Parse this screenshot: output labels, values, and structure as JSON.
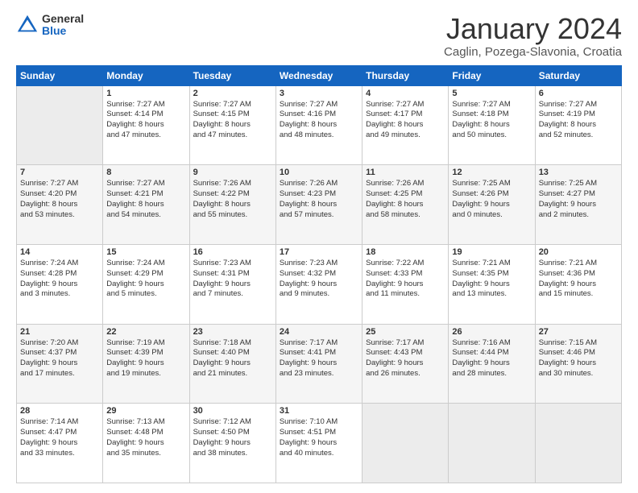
{
  "logo": {
    "general": "General",
    "blue": "Blue"
  },
  "title": "January 2024",
  "subtitle": "Caglin, Pozega-Slavonia, Croatia",
  "headers": [
    "Sunday",
    "Monday",
    "Tuesday",
    "Wednesday",
    "Thursday",
    "Friday",
    "Saturday"
  ],
  "weeks": [
    [
      {
        "day": "",
        "info": ""
      },
      {
        "day": "1",
        "info": "Sunrise: 7:27 AM\nSunset: 4:14 PM\nDaylight: 8 hours\nand 47 minutes."
      },
      {
        "day": "2",
        "info": "Sunrise: 7:27 AM\nSunset: 4:15 PM\nDaylight: 8 hours\nand 47 minutes."
      },
      {
        "day": "3",
        "info": "Sunrise: 7:27 AM\nSunset: 4:16 PM\nDaylight: 8 hours\nand 48 minutes."
      },
      {
        "day": "4",
        "info": "Sunrise: 7:27 AM\nSunset: 4:17 PM\nDaylight: 8 hours\nand 49 minutes."
      },
      {
        "day": "5",
        "info": "Sunrise: 7:27 AM\nSunset: 4:18 PM\nDaylight: 8 hours\nand 50 minutes."
      },
      {
        "day": "6",
        "info": "Sunrise: 7:27 AM\nSunset: 4:19 PM\nDaylight: 8 hours\nand 52 minutes."
      }
    ],
    [
      {
        "day": "7",
        "info": "Sunrise: 7:27 AM\nSunset: 4:20 PM\nDaylight: 8 hours\nand 53 minutes."
      },
      {
        "day": "8",
        "info": "Sunrise: 7:27 AM\nSunset: 4:21 PM\nDaylight: 8 hours\nand 54 minutes."
      },
      {
        "day": "9",
        "info": "Sunrise: 7:26 AM\nSunset: 4:22 PM\nDaylight: 8 hours\nand 55 minutes."
      },
      {
        "day": "10",
        "info": "Sunrise: 7:26 AM\nSunset: 4:23 PM\nDaylight: 8 hours\nand 57 minutes."
      },
      {
        "day": "11",
        "info": "Sunrise: 7:26 AM\nSunset: 4:25 PM\nDaylight: 8 hours\nand 58 minutes."
      },
      {
        "day": "12",
        "info": "Sunrise: 7:25 AM\nSunset: 4:26 PM\nDaylight: 9 hours\nand 0 minutes."
      },
      {
        "day": "13",
        "info": "Sunrise: 7:25 AM\nSunset: 4:27 PM\nDaylight: 9 hours\nand 2 minutes."
      }
    ],
    [
      {
        "day": "14",
        "info": "Sunrise: 7:24 AM\nSunset: 4:28 PM\nDaylight: 9 hours\nand 3 minutes."
      },
      {
        "day": "15",
        "info": "Sunrise: 7:24 AM\nSunset: 4:29 PM\nDaylight: 9 hours\nand 5 minutes."
      },
      {
        "day": "16",
        "info": "Sunrise: 7:23 AM\nSunset: 4:31 PM\nDaylight: 9 hours\nand 7 minutes."
      },
      {
        "day": "17",
        "info": "Sunrise: 7:23 AM\nSunset: 4:32 PM\nDaylight: 9 hours\nand 9 minutes."
      },
      {
        "day": "18",
        "info": "Sunrise: 7:22 AM\nSunset: 4:33 PM\nDaylight: 9 hours\nand 11 minutes."
      },
      {
        "day": "19",
        "info": "Sunrise: 7:21 AM\nSunset: 4:35 PM\nDaylight: 9 hours\nand 13 minutes."
      },
      {
        "day": "20",
        "info": "Sunrise: 7:21 AM\nSunset: 4:36 PM\nDaylight: 9 hours\nand 15 minutes."
      }
    ],
    [
      {
        "day": "21",
        "info": "Sunrise: 7:20 AM\nSunset: 4:37 PM\nDaylight: 9 hours\nand 17 minutes."
      },
      {
        "day": "22",
        "info": "Sunrise: 7:19 AM\nSunset: 4:39 PM\nDaylight: 9 hours\nand 19 minutes."
      },
      {
        "day": "23",
        "info": "Sunrise: 7:18 AM\nSunset: 4:40 PM\nDaylight: 9 hours\nand 21 minutes."
      },
      {
        "day": "24",
        "info": "Sunrise: 7:17 AM\nSunset: 4:41 PM\nDaylight: 9 hours\nand 23 minutes."
      },
      {
        "day": "25",
        "info": "Sunrise: 7:17 AM\nSunset: 4:43 PM\nDaylight: 9 hours\nand 26 minutes."
      },
      {
        "day": "26",
        "info": "Sunrise: 7:16 AM\nSunset: 4:44 PM\nDaylight: 9 hours\nand 28 minutes."
      },
      {
        "day": "27",
        "info": "Sunrise: 7:15 AM\nSunset: 4:46 PM\nDaylight: 9 hours\nand 30 minutes."
      }
    ],
    [
      {
        "day": "28",
        "info": "Sunrise: 7:14 AM\nSunset: 4:47 PM\nDaylight: 9 hours\nand 33 minutes."
      },
      {
        "day": "29",
        "info": "Sunrise: 7:13 AM\nSunset: 4:48 PM\nDaylight: 9 hours\nand 35 minutes."
      },
      {
        "day": "30",
        "info": "Sunrise: 7:12 AM\nSunset: 4:50 PM\nDaylight: 9 hours\nand 38 minutes."
      },
      {
        "day": "31",
        "info": "Sunrise: 7:10 AM\nSunset: 4:51 PM\nDaylight: 9 hours\nand 40 minutes."
      },
      {
        "day": "",
        "info": ""
      },
      {
        "day": "",
        "info": ""
      },
      {
        "day": "",
        "info": ""
      }
    ]
  ]
}
